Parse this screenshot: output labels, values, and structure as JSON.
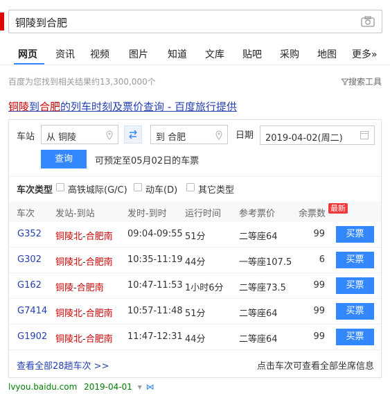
{
  "search": {
    "query": "铜陵到合肥"
  },
  "nav": {
    "items": [
      {
        "label": "网页",
        "active": true
      },
      {
        "label": "资讯"
      },
      {
        "label": "视频"
      },
      {
        "label": "图片"
      },
      {
        "label": "知道"
      },
      {
        "label": "文库"
      },
      {
        "label": "贴吧"
      },
      {
        "label": "采购"
      },
      {
        "label": "地图"
      },
      {
        "label": "更多»"
      }
    ]
  },
  "results": {
    "count_text": "百度为您找到相关结果约13,300,000个",
    "tools_label": "搜索工具"
  },
  "result": {
    "title_hl1": "铜陵",
    "title_mid": "到",
    "title_hl2": "合肥",
    "title_rest": "的列车时刻及票价查询 - 百度旅行提供"
  },
  "form": {
    "station_label": "车站",
    "from_value": "从 铜陵",
    "to_value": "到 合肥",
    "date_label": "日期",
    "date_value": "2019-04-02(周二)",
    "query_label": "查询",
    "presale_text": "可预定至05月02日的车票"
  },
  "filter": {
    "title": "车次类型",
    "options": [
      "高铁城际(G/C)",
      "动车(D)",
      "其它类型"
    ]
  },
  "table": {
    "headers": [
      "车次",
      "发站-到站",
      "发时-到时",
      "运行时间",
      "参考票价",
      "余票数"
    ],
    "new_badge": "最新",
    "buy_label": "买票",
    "rows": [
      {
        "train": "G352",
        "from": "铜陵北",
        "to": "合肥南",
        "time": "09:04-09:55",
        "duration": "51分",
        "price": "二等座64",
        "left": "99"
      },
      {
        "train": "G302",
        "from": "铜陵北",
        "to": "合肥南",
        "time": "10:35-11:19",
        "duration": "44分",
        "price": "一等座107.5",
        "left": "6"
      },
      {
        "train": "G162",
        "from": "铜陵",
        "to": "合肥南",
        "time": "10:47-11:53",
        "duration": "1小时6分",
        "price": "二等座73.5",
        "left": "99"
      },
      {
        "train": "G7414",
        "from": "铜陵北",
        "to": "合肥南",
        "time": "10:57-11:48",
        "duration": "51分",
        "price": "二等座64",
        "left": "99"
      },
      {
        "train": "G1902",
        "from": "铜陵北",
        "to": "合肥南",
        "time": "11:47-12:31",
        "duration": "44分",
        "price": "二等座64",
        "left": "99"
      }
    ]
  },
  "footer": {
    "view_all": "查看全部28趟车次 >>",
    "note": "点击车次可查看全部坐席信息"
  },
  "source": {
    "domain": "lvyou.baidu.com",
    "date": "2019-04-01"
  },
  "colors": {
    "accent": "#3388ff",
    "link": "#2440b3",
    "highlight": "#cc0000",
    "url_green": "#008000"
  }
}
